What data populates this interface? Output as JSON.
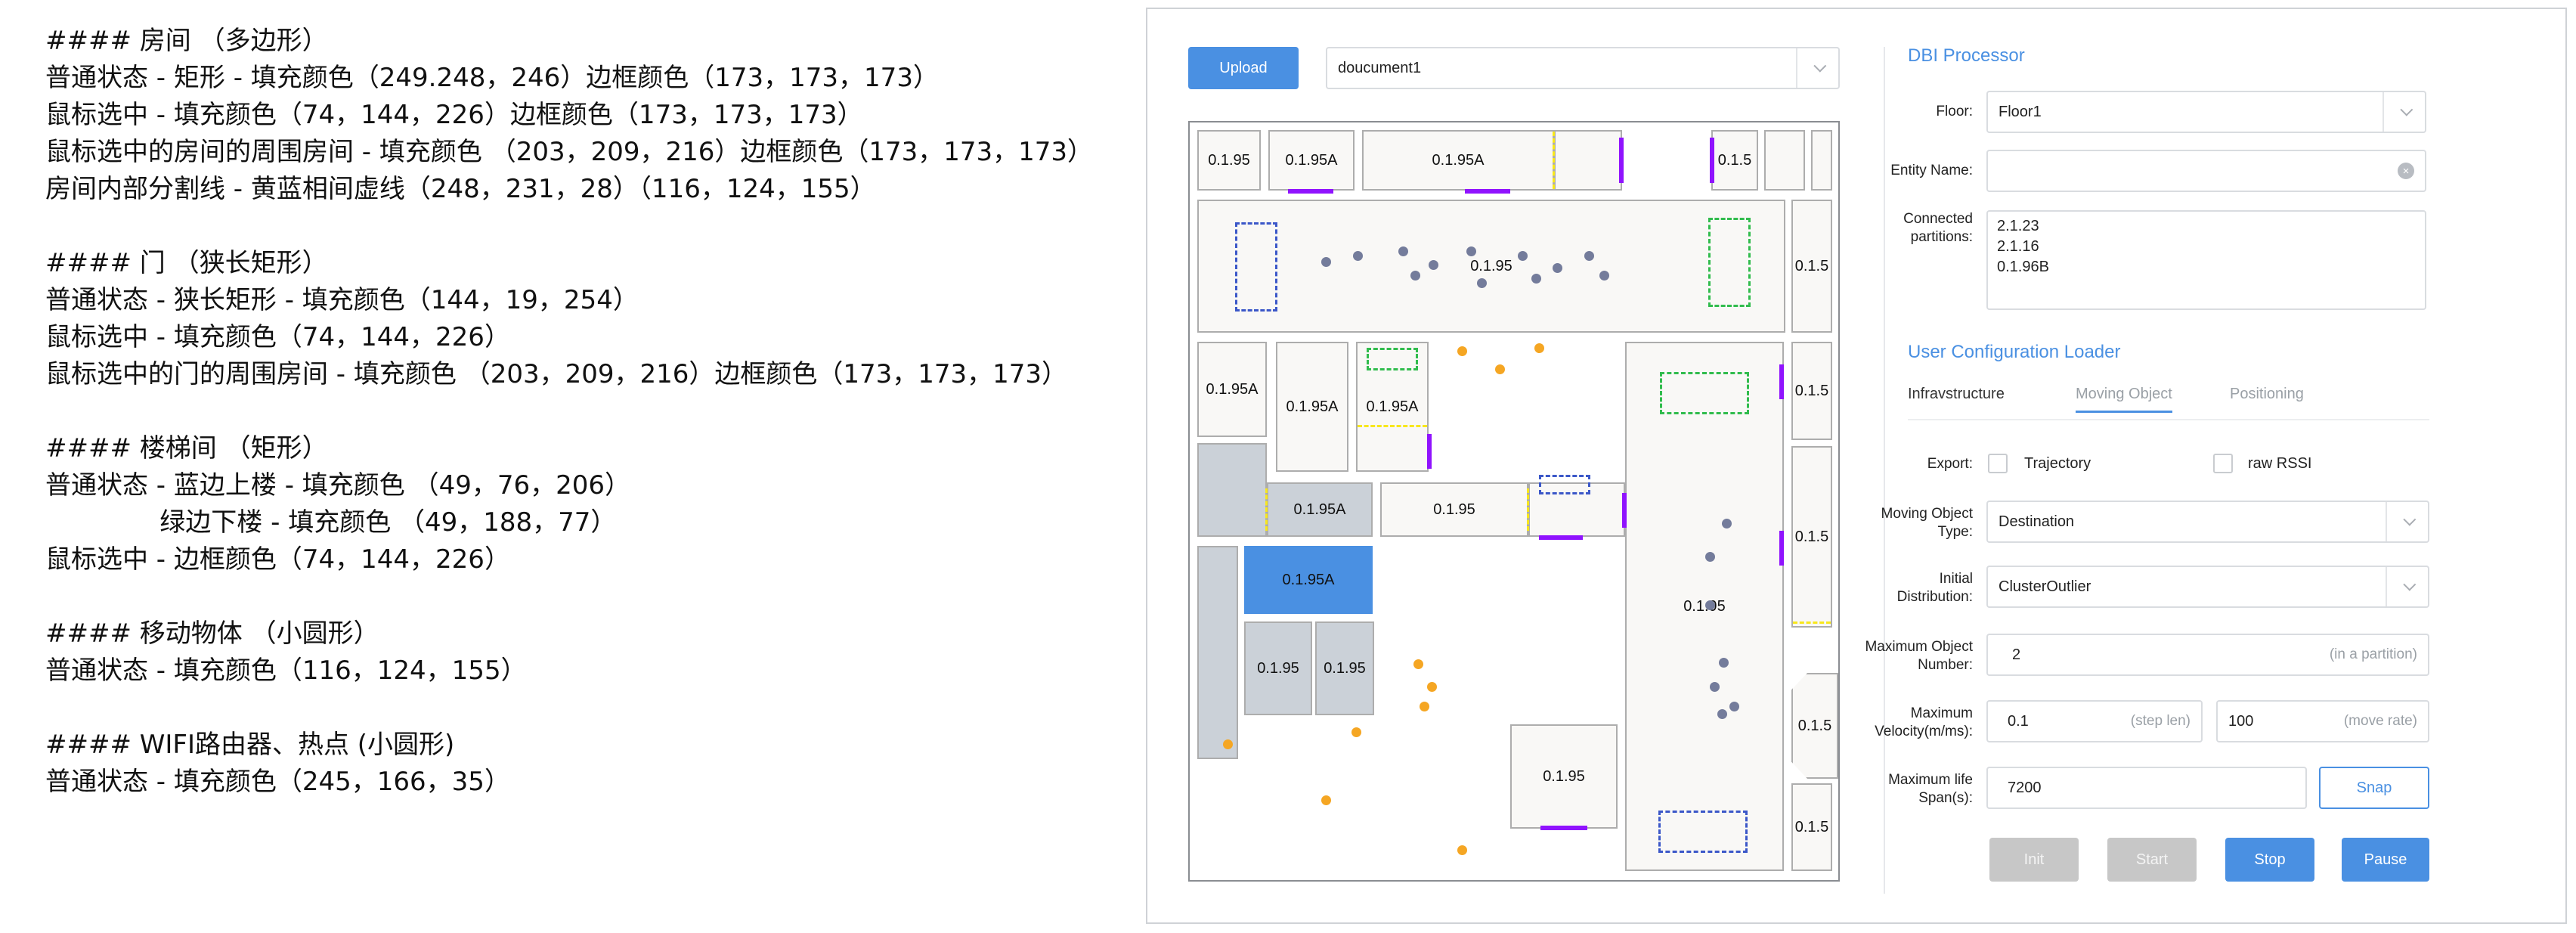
{
  "notes": [
    "#### 房间 （多边形）",
    "普通状态 - 矩形 - 填充颜色（249.248，246）边框颜色（173，173，173）",
    "鼠标选中 - 填充颜色（74，144，226）边框颜色（173，173，173）",
    "鼠标选中的房间的周围房间 - 填充颜色 （203，209，216）边框颜色（173，173，173）",
    "房间内部分割线 - 黄蓝相间虚线（248，231，28）（116，124，155）",
    "",
    "#### 门 （狭长矩形）",
    "普通状态 - 狭长矩形 - 填充颜色（144，19，254）",
    "鼠标选中 - 填充颜色（74，144，226）",
    "鼠标选中的门的周围房间 - 填充颜色 （203，209，216）边框颜色（173，173，173）",
    "",
    "#### 楼梯间 （矩形）",
    "普通状态 - 蓝边上楼 - 填充颜色 （49，76，206）",
    "              绿边下楼 - 填充颜色 （49，188，77）",
    "鼠标选中 - 边框颜色（74，144，226）",
    "",
    "#### 移动物体 （小圆形）",
    "普通状态 - 填充颜色（116，124，155）",
    "",
    "#### WIFI路由器、热点 (小圆形)",
    "普通状态 - 填充颜色（245，166，35）"
  ],
  "toolbar": {
    "upload_label": "Upload",
    "document_value": "doucument1"
  },
  "map": {
    "rooms": {
      "r1": "0.1.95",
      "r2": "0.1.95A",
      "r3": "0.1.95A",
      "r4": "0.1.5",
      "big_top": "0.1.95",
      "right1": "0.1.5",
      "l1": "0.1.95A",
      "l2": "0.1.95A",
      "l3": "0.1.95A",
      "right2": "0.1.5",
      "mid_a": "0.1.95A",
      "mid_b": "0.1.95",
      "selected": "0.1.95A",
      "tall_right": "0.1.95",
      "right3": "0.1.5",
      "small1": "0.1.95",
      "small2": "0.1.95",
      "right4": "0.1.5",
      "bottom_mid": "0.1.95",
      "right5": "0.1.5"
    }
  },
  "colors": {
    "room_fill": "#f9f8f6",
    "room_border": "#adadad",
    "selected": "#4a90e2",
    "stair_neighbor": "#cbd1d8",
    "door": "#9013fe",
    "stair_up": "#314cce",
    "stair_down": "#31bc4d",
    "object": "#747c9b",
    "wifi": "#f5a623"
  },
  "dbi": {
    "title": "DBI Processor",
    "floor_label": "Floor:",
    "floor_value": "Floor1",
    "entity_label": "Entity Name:",
    "entity_value": "",
    "connected_label_1": "Connected",
    "connected_label_2": "partitions:",
    "partitions": [
      "2.1.23",
      "2.1.16",
      "0.1.96B"
    ]
  },
  "config": {
    "title": "User Configuration Loader",
    "tabs": [
      "Infravstructure",
      "Moving Object",
      "Positioning"
    ],
    "export_label": "Export:",
    "export_options": [
      "Trajectory",
      "raw RSSI"
    ],
    "mo_type_label_1": "Moving Object",
    "mo_type_label_2": "Type:",
    "mo_type_value": "Destination",
    "init_dist_label_1": "Initial",
    "init_dist_label_2": "Distribution:",
    "init_dist_value": "ClusterOutlier",
    "max_obj_label_1": "Maximum Object",
    "max_obj_label_2": "Number:",
    "max_obj_value": "2",
    "max_obj_hint": "(in a partition)",
    "max_vel_label_1": "Maximum",
    "max_vel_label_2": "Velocity(m/ms):",
    "step_len_value": "0.1",
    "step_len_hint": "(step len)",
    "move_rate_value": "100",
    "move_rate_hint": "(move rate)",
    "life_label_1": "Maximum life",
    "life_label_2": "Span(s):",
    "life_value": "7200",
    "snap_label": "Snap",
    "buttons": {
      "init": "Init",
      "start": "Start",
      "stop": "Stop",
      "pause": "Pause"
    }
  }
}
